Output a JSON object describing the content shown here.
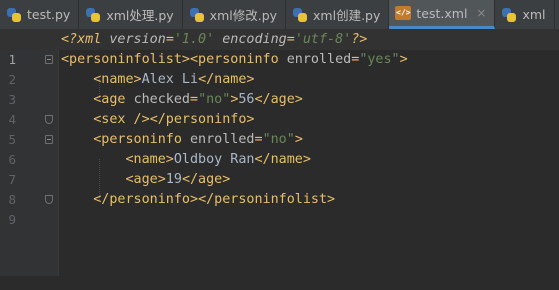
{
  "tabs": [
    {
      "label": "test.py",
      "icon": "python-file-icon",
      "active": false
    },
    {
      "label": "xml处理.py",
      "icon": "python-file-icon",
      "active": false
    },
    {
      "label": "xml修改.py",
      "icon": "python-file-icon",
      "active": false
    },
    {
      "label": "xml创建.py",
      "icon": "python-file-icon",
      "active": false
    },
    {
      "label": "test.xml",
      "icon": "xml-file-icon",
      "active": true
    },
    {
      "label": "xml",
      "icon": "python-file-icon",
      "active": false
    }
  ],
  "close_glyph": "×",
  "xml_icon_text": "</>",
  "editor": {
    "current_line": 1,
    "line_numbers": [
      "1",
      "2",
      "3",
      "4",
      "5",
      "6",
      "7",
      "8",
      "9"
    ],
    "tokens": {
      "l1": {
        "open": "<?",
        "name": "xml",
        "attr1": "version",
        "eq1": "=",
        "val1": "'1.0'",
        "attr2": "encoding",
        "eq2": "=",
        "val2": "'utf-8'",
        "close": "?>"
      },
      "l2": {
        "tag1": "<personinfolist>",
        "open2": "<personinfo",
        "attr": "enrolled",
        "eq": "=",
        "val": "\"yes\"",
        "end": ">"
      },
      "l3": {
        "open": "<name>",
        "text": "Alex Li",
        "close": "</name>"
      },
      "l4": {
        "open": "<age",
        "attr": "checked",
        "eq": "=",
        "val": "\"no\"",
        "gt": ">",
        "text": "56",
        "close": "</age>"
      },
      "l5": {
        "tag": "<sex />",
        "close": "</personinfo>"
      },
      "l6": {
        "open": "<personinfo",
        "attr": "enrolled",
        "eq": "=",
        "val": "\"no\"",
        "end": ">"
      },
      "l7": {
        "open": "<name>",
        "text": "Oldboy Ran",
        "close": "</name>"
      },
      "l8": {
        "open": "<age>",
        "text": "19",
        "close": "</age>"
      },
      "l9": {
        "close1": "</personinfo>",
        "close2": "</personinfolist>"
      }
    }
  },
  "colors": {
    "background": "#2b2b2b",
    "gutter": "#313335",
    "tag": "#e8bf6a",
    "attribute": "#bababa",
    "value": "#6a8759",
    "text": "#a9b7c6",
    "active_tab_underline": "#4a88c7"
  }
}
